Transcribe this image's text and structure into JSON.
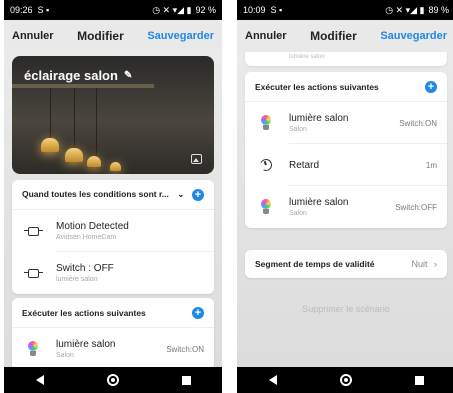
{
  "left": {
    "status": {
      "time": "09:26",
      "battery": "92 %"
    },
    "topbar": {
      "cancel": "Annuler",
      "title": "Modifier",
      "save": "Sauvegarder"
    },
    "scene_name": "éclairage salon",
    "conditions": {
      "header": "Quand toutes les conditions sont r...",
      "items": [
        {
          "title": "Motion Detected",
          "subtitle": "Avidsen HomeCam"
        },
        {
          "title": "Switch : OFF",
          "subtitle": "lumière salon"
        }
      ]
    },
    "actions": {
      "header": "Exécuter les actions suivantes",
      "items": [
        {
          "title": "lumière salon",
          "subtitle": "Salon",
          "value": "Switch:ON"
        }
      ]
    }
  },
  "right": {
    "status": {
      "time": "10:09",
      "battery": "89 %"
    },
    "topbar": {
      "cancel": "Annuler",
      "title": "Modifier",
      "save": "Sauvegarder"
    },
    "faded_top": "lumière salon",
    "actions": {
      "header": "Exécuter les actions suivantes",
      "items": [
        {
          "title": "lumière salon",
          "subtitle": "Salon",
          "value": "Switch:ON"
        },
        {
          "title": "Retard",
          "value": "1m"
        },
        {
          "title": "lumière salon",
          "subtitle": "Salon",
          "value": "Switch:OFF"
        }
      ]
    },
    "validity": {
      "label": "Segment de temps de validité",
      "value": "Nuit"
    },
    "delete": "Supprimer le scénario"
  },
  "colors": {
    "accent": "#1e88e5"
  }
}
